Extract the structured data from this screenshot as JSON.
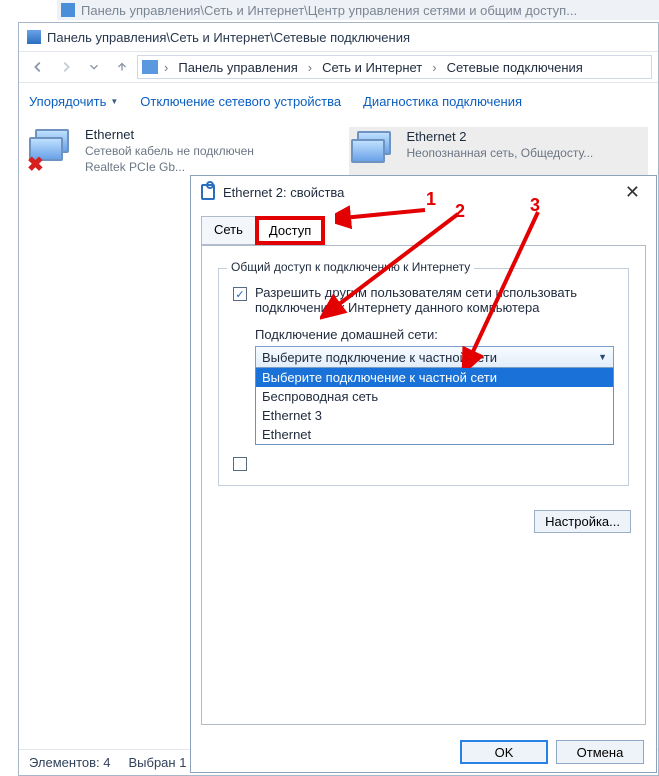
{
  "back_title": "Панель управления\\Сеть и Интернет\\Центр управления сетями и общим доступ...",
  "window_title": "Панель управления\\Сеть и Интернет\\Сетевые подключения",
  "breadcrumb": {
    "root": "Панель управления",
    "mid": "Сеть и Интернет",
    "leaf": "Сетевые подключения"
  },
  "commands": {
    "organize": "Упорядочить",
    "disable": "Отключение сетевого устройства",
    "diagnose": "Диагностика подключения"
  },
  "adapters": [
    {
      "name": "Ethernet",
      "status": "Сетевой кабель не подключен",
      "device": "Realtek PCIe Gb..."
    },
    {
      "name": "Ethernet 2",
      "status": "Неопознанная сеть, Общедосту...",
      "device": ""
    }
  ],
  "statusbar": {
    "count_label": "Элементов: 4",
    "selected_label": "Выбран 1"
  },
  "dialog": {
    "title": "Ethernet 2: свойства",
    "tabs": {
      "network": "Сеть",
      "sharing": "Доступ"
    },
    "group_title": "Общий доступ к подключению к Интернету",
    "allow_label": "Разрешить другим пользователям сети использовать подключение к Интернету данного компьютера",
    "home_label": "Подключение домашней сети:",
    "combo_selected": "Выберите подключение к частной сети",
    "combo_options": [
      "Выберите подключение к частной сети",
      "Беспроводная сеть",
      "Ethernet 3",
      "Ethernet"
    ],
    "allow_control": "",
    "settings_btn": "Настройка...",
    "ok": "OK",
    "cancel": "Отмена"
  },
  "annotations": {
    "n1": "1",
    "n2": "2",
    "n3": "3"
  }
}
